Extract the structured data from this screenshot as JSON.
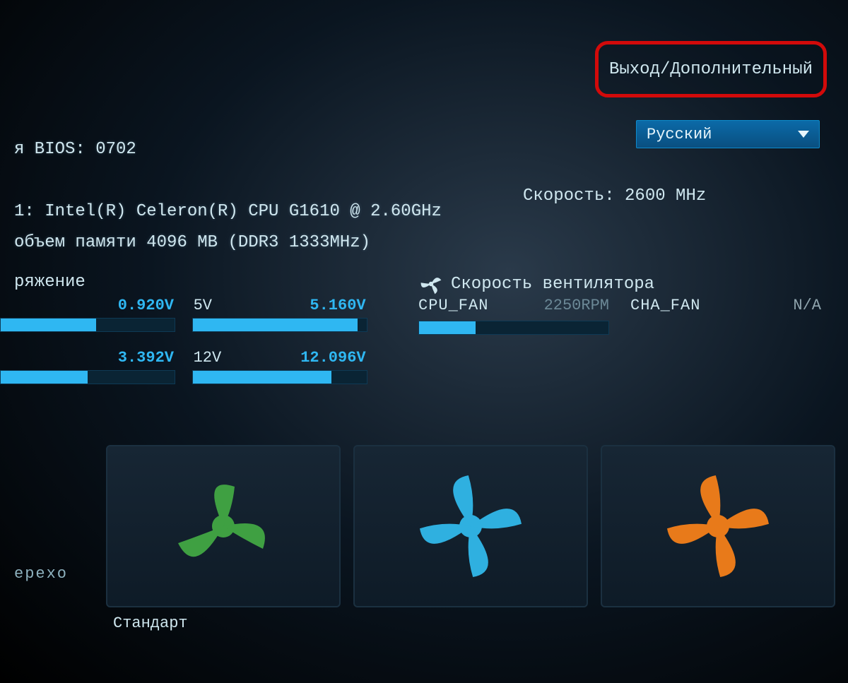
{
  "header": {
    "exit_label": "Выход/Дополнительный",
    "language": "Русский"
  },
  "info": {
    "bios_line": "я BIOS: 0702",
    "cpu_line": "1: Intel(R) Celeron(R) CPU G1610 @ 2.60GHz",
    "memory_line": "объем памяти 4096 MB (DDR3 1333MHz)",
    "speed_label": "Скорость: 2600 MHz"
  },
  "voltage": {
    "title": "ряжение",
    "items": [
      {
        "name": "",
        "value": "0.920V",
        "fill": 55
      },
      {
        "name": "5V",
        "value": "5.160V",
        "fill": 95
      },
      {
        "name": "",
        "value": "3.392V",
        "fill": 50
      },
      {
        "name": "12V",
        "value": "12.096V",
        "fill": 80
      }
    ]
  },
  "fan": {
    "title": "Скорость вентилятора",
    "items": [
      {
        "name": "CPU_FAN",
        "value": "2250RPM",
        "fill": 30
      },
      {
        "name": "CHA_FAN",
        "value": "N/A",
        "fill": 0
      }
    ]
  },
  "profiles": {
    "left_trunc": "ерехо",
    "label_standard": "Стандарт",
    "colors": {
      "eco": "#3fa042",
      "std": "#2fb0e0",
      "turbo": "#e87a1a"
    }
  }
}
